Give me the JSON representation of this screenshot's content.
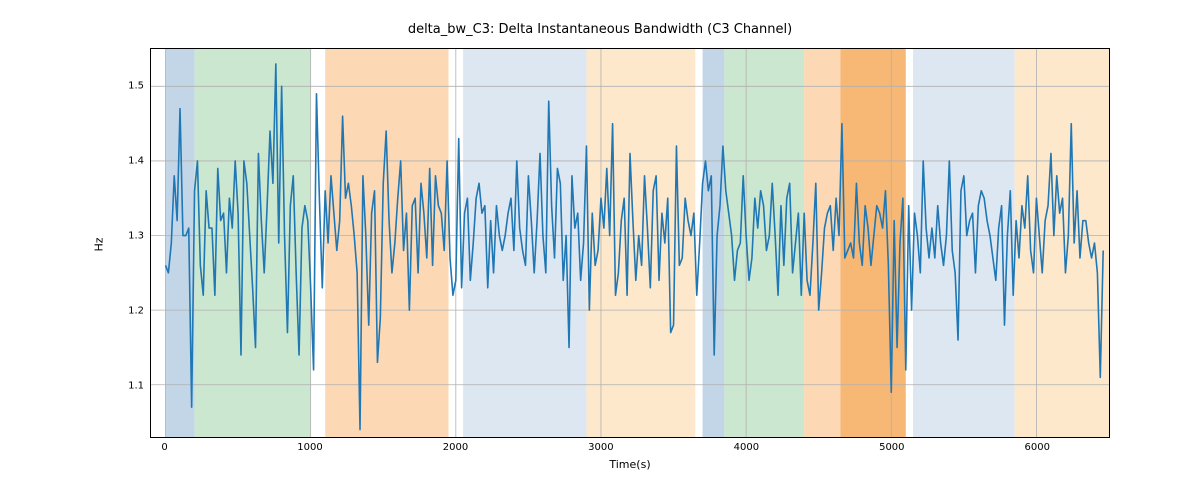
{
  "chart_data": {
    "type": "line",
    "title": "delta_bw_C3: Delta Instantaneous Bandwidth (C3 Channel)",
    "xlabel": "Time(s)",
    "ylabel": "Hz",
    "xlim": [
      -100,
      6500
    ],
    "ylim": [
      1.03,
      1.55
    ],
    "xticks": [
      0,
      1000,
      2000,
      3000,
      4000,
      5000,
      6000
    ],
    "yticks": [
      1.1,
      1.2,
      1.3,
      1.4,
      1.5
    ],
    "line_color": "#1f77b4",
    "background_bands": [
      {
        "x0": 0,
        "x1": 200,
        "color": "#c2d6e8"
      },
      {
        "x0": 200,
        "x1": 1000,
        "color": "#cce7cf"
      },
      {
        "x0": 1100,
        "x1": 1950,
        "color": "#fcd9b4"
      },
      {
        "x0": 2050,
        "x1": 2900,
        "color": "#dde7f2"
      },
      {
        "x0": 2900,
        "x1": 3650,
        "color": "#fde8cc"
      },
      {
        "x0": 3700,
        "x1": 3850,
        "color": "#c2d6e8"
      },
      {
        "x0": 3850,
        "x1": 4400,
        "color": "#cce7cf"
      },
      {
        "x0": 4400,
        "x1": 4650,
        "color": "#fcd9b4"
      },
      {
        "x0": 4650,
        "x1": 5100,
        "color": "#f7b875"
      },
      {
        "x0": 5150,
        "x1": 5850,
        "color": "#dde7f2"
      },
      {
        "x0": 5850,
        "x1": 6500,
        "color": "#fde8cc"
      }
    ],
    "grid": {
      "x": true,
      "y": true,
      "color": "#b0b0b0"
    },
    "series": [
      {
        "name": "delta_bw_C3",
        "x_step": 20,
        "x_start": 0,
        "values": [
          1.26,
          1.25,
          1.29,
          1.38,
          1.32,
          1.47,
          1.3,
          1.3,
          1.31,
          1.07,
          1.36,
          1.4,
          1.26,
          1.22,
          1.36,
          1.31,
          1.31,
          1.22,
          1.39,
          1.32,
          1.33,
          1.25,
          1.35,
          1.31,
          1.4,
          1.33,
          1.14,
          1.4,
          1.37,
          1.3,
          1.23,
          1.15,
          1.41,
          1.32,
          1.25,
          1.34,
          1.44,
          1.37,
          1.53,
          1.29,
          1.5,
          1.3,
          1.17,
          1.34,
          1.38,
          1.25,
          1.14,
          1.31,
          1.34,
          1.32,
          1.23,
          1.12,
          1.49,
          1.35,
          1.23,
          1.36,
          1.29,
          1.38,
          1.33,
          1.28,
          1.32,
          1.46,
          1.35,
          1.37,
          1.34,
          1.3,
          1.25,
          1.04,
          1.38,
          1.3,
          1.18,
          1.33,
          1.36,
          1.13,
          1.19,
          1.37,
          1.44,
          1.32,
          1.25,
          1.29,
          1.35,
          1.4,
          1.28,
          1.33,
          1.2,
          1.34,
          1.35,
          1.25,
          1.37,
          1.33,
          1.27,
          1.39,
          1.26,
          1.38,
          1.34,
          1.33,
          1.28,
          1.4,
          1.27,
          1.22,
          1.24,
          1.43,
          1.23,
          1.33,
          1.35,
          1.24,
          1.29,
          1.35,
          1.37,
          1.33,
          1.34,
          1.23,
          1.32,
          1.25,
          1.34,
          1.3,
          1.28,
          1.3,
          1.33,
          1.35,
          1.28,
          1.4,
          1.31,
          1.28,
          1.26,
          1.38,
          1.32,
          1.25,
          1.32,
          1.41,
          1.3,
          1.25,
          1.48,
          1.34,
          1.27,
          1.39,
          1.37,
          1.24,
          1.3,
          1.15,
          1.38,
          1.31,
          1.33,
          1.24,
          1.29,
          1.42,
          1.2,
          1.33,
          1.26,
          1.28,
          1.35,
          1.31,
          1.39,
          1.3,
          1.45,
          1.22,
          1.25,
          1.32,
          1.35,
          1.22,
          1.41,
          1.32,
          1.24,
          1.3,
          1.26,
          1.38,
          1.31,
          1.23,
          1.36,
          1.38,
          1.24,
          1.33,
          1.29,
          1.35,
          1.17,
          1.18,
          1.42,
          1.26,
          1.27,
          1.35,
          1.32,
          1.3,
          1.33,
          1.22,
          1.29,
          1.37,
          1.4,
          1.36,
          1.38,
          1.14,
          1.3,
          1.34,
          1.42,
          1.36,
          1.33,
          1.3,
          1.24,
          1.28,
          1.29,
          1.38,
          1.3,
          1.24,
          1.27,
          1.35,
          1.31,
          1.36,
          1.34,
          1.28,
          1.3,
          1.37,
          1.3,
          1.22,
          1.34,
          1.26,
          1.35,
          1.37,
          1.25,
          1.29,
          1.33,
          1.22,
          1.33,
          1.24,
          1.22,
          1.29,
          1.37,
          1.2,
          1.25,
          1.31,
          1.33,
          1.34,
          1.28,
          1.35,
          1.3,
          1.45,
          1.27,
          1.28,
          1.29,
          1.27,
          1.37,
          1.29,
          1.26,
          1.34,
          1.31,
          1.26,
          1.3,
          1.34,
          1.33,
          1.31,
          1.36,
          1.26,
          1.09,
          1.32,
          1.15,
          1.29,
          1.35,
          1.12,
          1.34,
          1.2,
          1.33,
          1.3,
          1.25,
          1.4,
          1.31,
          1.27,
          1.31,
          1.27,
          1.34,
          1.29,
          1.26,
          1.3,
          1.4,
          1.28,
          1.25,
          1.16,
          1.36,
          1.38,
          1.3,
          1.32,
          1.33,
          1.25,
          1.34,
          1.36,
          1.35,
          1.32,
          1.3,
          1.27,
          1.24,
          1.31,
          1.34,
          1.18,
          1.3,
          1.36,
          1.22,
          1.32,
          1.27,
          1.34,
          1.31,
          1.38,
          1.28,
          1.25,
          1.35,
          1.3,
          1.25,
          1.32,
          1.34,
          1.41,
          1.3,
          1.38,
          1.33,
          1.35,
          1.25,
          1.3,
          1.45,
          1.29,
          1.36,
          1.27,
          1.32,
          1.32,
          1.29,
          1.27,
          1.29,
          1.25,
          1.11,
          1.28
        ]
      }
    ]
  }
}
